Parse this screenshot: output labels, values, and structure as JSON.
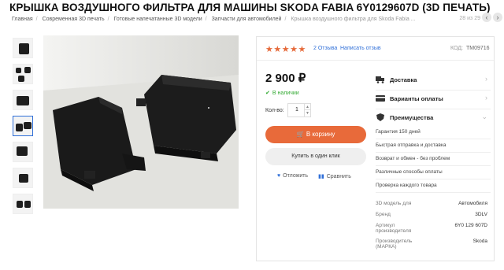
{
  "title": "КРЫШКА ВОЗДУШНОГО ФИЛЬТРА ДЛЯ МАШИНЫ SKODA FABIA 6Y0129607D (3D ПЕЧАТЬ)",
  "counter": "28 из 29",
  "breadcrumb": [
    "Главная",
    "Современная 3D печать",
    "Готовые напечатанные 3D модели",
    "Запчасти для автомобилей",
    "Крышка воздушного фильтра для Skoda Fabia ..."
  ],
  "rating": {
    "stars": "★★★★★",
    "reviews": "2 Отзыва",
    "write_review": "Написать отзыв"
  },
  "sku": {
    "label": "КОД:",
    "value": "TM09716"
  },
  "price": "2 900 ₽",
  "stock": "В наличии",
  "quantity": {
    "label": "Кол-во:",
    "value": "1"
  },
  "buttons": {
    "cart": "В корзину",
    "one_click": "Купить в один клик"
  },
  "actions": {
    "favorite": "Отложить",
    "compare": "Сравнить"
  },
  "panel": {
    "delivery": "Доставка",
    "payment": "Варианты оплаты",
    "advantages": "Преимущества"
  },
  "advantages": [
    "Гарантия 150 дней",
    "Быстрая отправка и доставка",
    "Возврат и обмен - без проблем",
    "Различные способы оплаты",
    "Проверка каждого товара"
  ],
  "specs": [
    {
      "key": "3D модель для",
      "value": "Автомобиля"
    },
    {
      "key": "Бренд",
      "value": "3DLV"
    },
    {
      "key": "Артикул производителя",
      "value": "6Y0 129 607D"
    },
    {
      "key": "Производитель (МАРКА)",
      "value": "Skoda"
    }
  ],
  "colors": {
    "accent": "#e86a3a",
    "link": "#2f6fd8",
    "in_stock": "#33aa33"
  },
  "icons": [
    "truck-icon",
    "card-icon",
    "shield-icon",
    "heart-icon",
    "bars-icon",
    "cart-icon",
    "check-icon"
  ]
}
